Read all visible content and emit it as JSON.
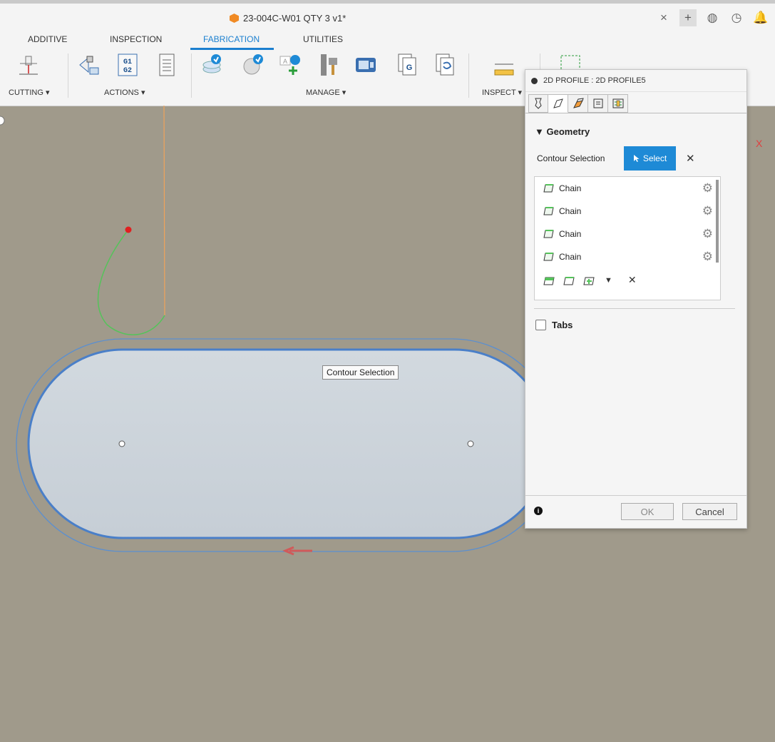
{
  "window": {
    "title": "23-004C-W01 QTY 3 v1*"
  },
  "tabs": [
    "ADDITIVE",
    "INSPECTION",
    "FABRICATION",
    "UTILITIES"
  ],
  "active_tab": "FABRICATION",
  "groups": {
    "cutting": "CUTTING ▾",
    "actions": "ACTIONS ▾",
    "manage": "MANAGE ▾",
    "inspect": "INSPECT ▾"
  },
  "tooltip": "Contour Selection",
  "panel": {
    "title": "2D PROFILE : 2D PROFILE5",
    "section": "▼ Geometry",
    "contour_label": "Contour Selection",
    "select_label": "Select",
    "chains": [
      "Chain",
      "Chain",
      "Chain",
      "Chain"
    ],
    "tabs_label": "Tabs",
    "ok": "OK",
    "cancel": "Cancel"
  },
  "colors": {
    "accent": "#1e8ad6",
    "viewport": "#a09a8b",
    "part_fill": "#cdd4da",
    "contour": "#4a7fc8"
  }
}
